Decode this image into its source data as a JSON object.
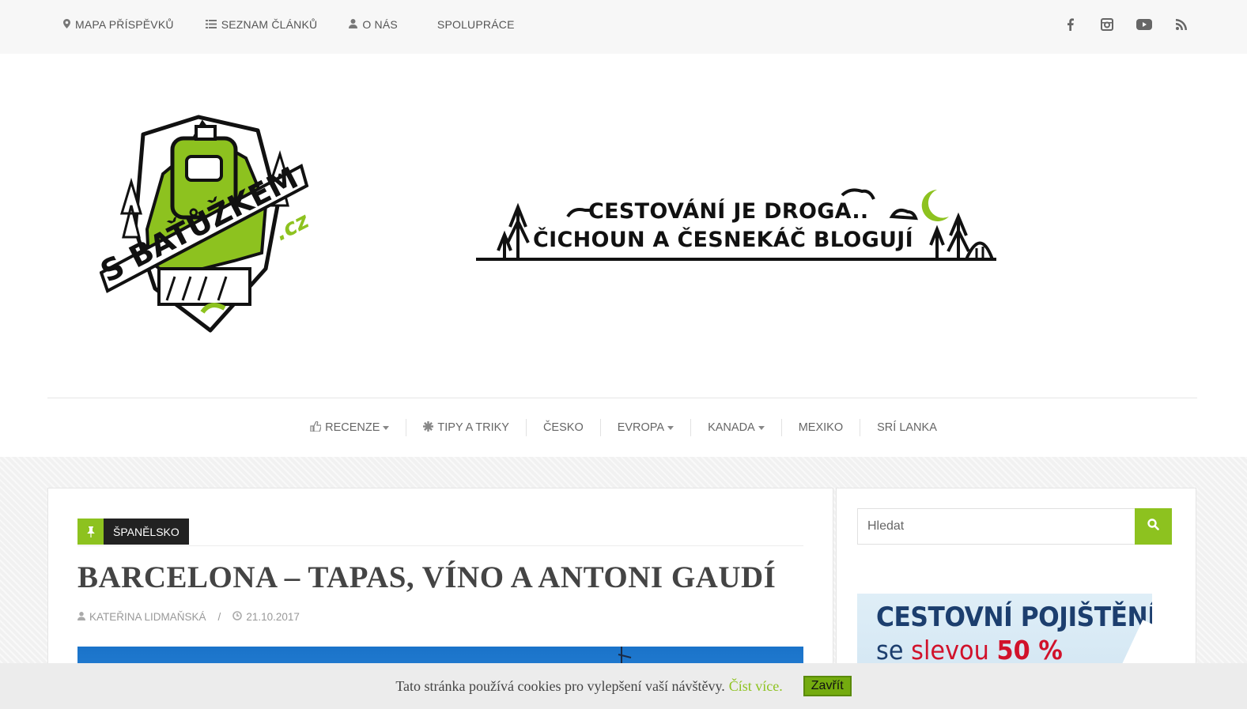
{
  "topnav": {
    "items": [
      {
        "label": "MAPA PŘÍSPĚVKŮ",
        "icon": "map-marker-icon"
      },
      {
        "label": "SEZNAM ČLÁNKŮ",
        "icon": "list-icon"
      },
      {
        "label": "O NÁS",
        "icon": "user-icon"
      },
      {
        "label": "SPOLUPRÁCE",
        "icon": ""
      }
    ],
    "social": [
      "facebook-icon",
      "instagram-icon",
      "youtube-icon",
      "rss-icon"
    ]
  },
  "header": {
    "logo_text": "S BAŤŮŽKEM",
    "logo_domain": ".cz",
    "banner_line1": "CESTOVÁNÍ JE DROGA..",
    "banner_line2": "ČICHOUN A ČESNEKÁČ BLOGUJÍ"
  },
  "mainnav": {
    "items": [
      {
        "label": "RECENZE",
        "icon": "thumbs-up-icon",
        "dropdown": true
      },
      {
        "label": "TIPY A TRIKY",
        "icon": "asterisk-icon",
        "dropdown": false
      },
      {
        "label": "ČESKO",
        "icon": "",
        "dropdown": false
      },
      {
        "label": "EVROPA",
        "icon": "",
        "dropdown": true
      },
      {
        "label": "KANADA",
        "icon": "",
        "dropdown": true
      },
      {
        "label": "MEXIKO",
        "icon": "",
        "dropdown": false
      },
      {
        "label": "SRÍ LANKA",
        "icon": "",
        "dropdown": false
      }
    ]
  },
  "post": {
    "category": "ŠPANĚLSKO",
    "title": "BARCELONA – TAPAS, VÍNO A ANTONI GAUDÍ",
    "author": "KATEŘINA LIDMAŇSKÁ",
    "date": "21.10.2017"
  },
  "sidebar": {
    "search_placeholder": "Hledat",
    "ad_line1": "CESTOVNÍ POJIŠTĚNÍ",
    "ad_line2_prefix": "se",
    "ad_line2_red": "slevou",
    "ad_line2_big": "50 %"
  },
  "cookie": {
    "text": "Tato stránka používá cookies pro vylepšení vaší návštěvy.",
    "more": "Číst více.",
    "close": "Zavřít"
  },
  "colors": {
    "accent": "#8dc21f",
    "dark": "#222222",
    "topbar_bg": "#f7f7f7"
  }
}
